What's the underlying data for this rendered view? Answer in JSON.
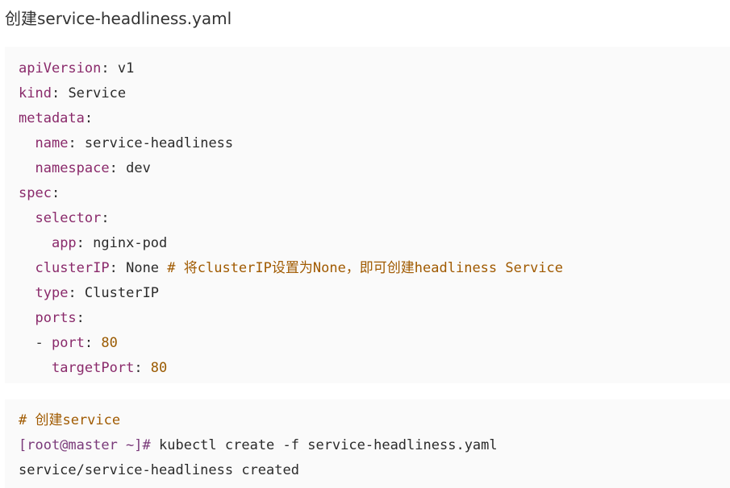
{
  "heading": "创建service-headliness.yaml",
  "yaml": [
    {
      "indent": "",
      "key": "apiVersion",
      "sep": ": ",
      "value": "v1",
      "comment": ""
    },
    {
      "indent": "",
      "key": "kind",
      "sep": ": ",
      "value": "Service",
      "comment": ""
    },
    {
      "indent": "",
      "key": "metadata",
      "sep": ":",
      "value": "",
      "comment": ""
    },
    {
      "indent": "  ",
      "key": "name",
      "sep": ": ",
      "value": "service-headliness",
      "comment": ""
    },
    {
      "indent": "  ",
      "key": "namespace",
      "sep": ": ",
      "value": "dev",
      "comment": ""
    },
    {
      "indent": "",
      "key": "spec",
      "sep": ":",
      "value": "",
      "comment": ""
    },
    {
      "indent": "  ",
      "key": "selector",
      "sep": ":",
      "value": "",
      "comment": ""
    },
    {
      "indent": "    ",
      "key": "app",
      "sep": ": ",
      "value": "nginx-pod",
      "comment": ""
    },
    {
      "indent": "  ",
      "key": "clusterIP",
      "sep": ": ",
      "value": "None ",
      "comment": "# 将clusterIP设置为None，即可创建headliness Service"
    },
    {
      "indent": "  ",
      "key": "type",
      "sep": ": ",
      "value": "ClusterIP",
      "comment": ""
    },
    {
      "indent": "  ",
      "key": "ports",
      "sep": ":",
      "value": "",
      "comment": ""
    },
    {
      "indent": "  - ",
      "key": "port",
      "sep": ": ",
      "value": "80",
      "comment": ""
    },
    {
      "indent": "    ",
      "key": "targetPort",
      "sep": ": ",
      "value": "80",
      "comment": ""
    }
  ],
  "shell": {
    "comment": "# 创建service",
    "prompt": "[root@master ~]#",
    "command": " kubectl create -f service-headliness.yaml",
    "output": "service/service-headliness created"
  }
}
